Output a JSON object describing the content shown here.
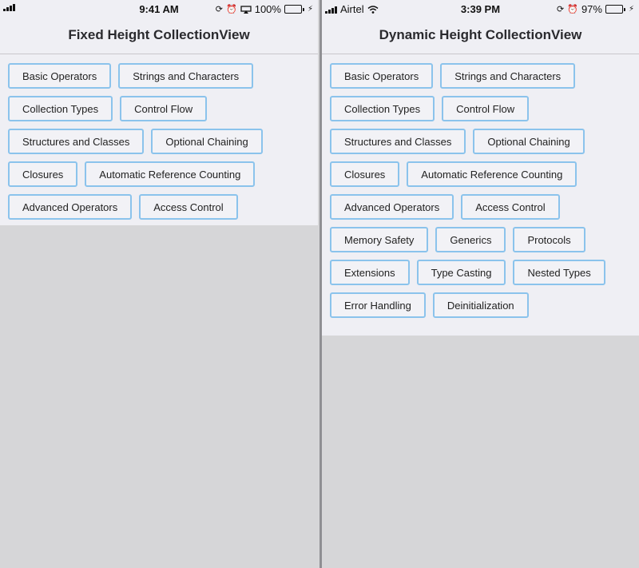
{
  "left": {
    "status": {
      "time": "9:41 AM",
      "battery": "100%",
      "battery_level": 1.0
    },
    "title": "Fixed Height CollectionView",
    "chips": [
      "Basic Operators",
      "Strings and Characters",
      "Collection Types",
      "Control Flow",
      "Structures and Classes",
      "Optional Chaining",
      "Closures",
      "Automatic Reference Counting",
      "Advanced Operators",
      "Access Control"
    ]
  },
  "right": {
    "status": {
      "carrier": "Airtel",
      "time": "3:39 PM",
      "battery": "97%",
      "battery_level": 0.97
    },
    "title": "Dynamic Height CollectionView",
    "chips": [
      "Basic Operators",
      "Strings and Characters",
      "Collection Types",
      "Control Flow",
      "Structures and Classes",
      "Optional Chaining",
      "Closures",
      "Automatic Reference Counting",
      "Advanced Operators",
      "Access Control",
      "Memory Safety",
      "Generics",
      "Protocols",
      "Extensions",
      "Type Casting",
      "Nested Types",
      "Error Handling",
      "Deinitialization"
    ]
  },
  "colors": {
    "chip_border": "#8bc3ec",
    "background": "#efeff4",
    "empty_area": "#d6d6d8"
  }
}
